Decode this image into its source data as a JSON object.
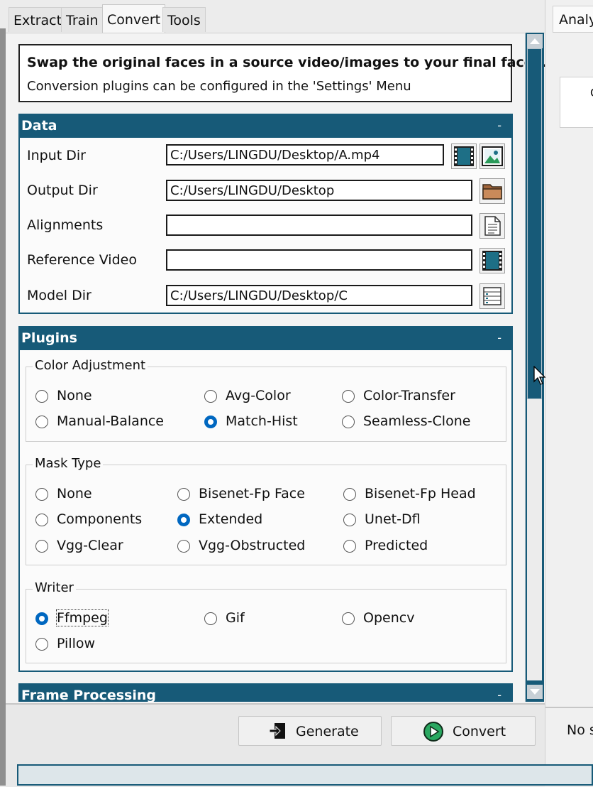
{
  "tabs": [
    "Extract",
    "Train",
    "Convert",
    "Tools"
  ],
  "right_tab": "Analy",
  "right_panel": {
    "box_char": "C",
    "status_text": "No s"
  },
  "description": {
    "title": "Swap the original faces in a source video/images to your final faces.",
    "subtitle": "Conversion plugins can be configured in the 'Settings' Menu"
  },
  "sections": {
    "data": {
      "title": "Data",
      "collapse": "-"
    },
    "plugins": {
      "title": "Plugins",
      "collapse": "-"
    },
    "frame": {
      "title": "Frame Processing",
      "collapse": "-"
    }
  },
  "fields": {
    "input_dir": {
      "label": "Input Dir",
      "value": "C:/Users/LINGDU/Desktop/A.mp4"
    },
    "output_dir": {
      "label": "Output Dir",
      "value": "C:/Users/LINGDU/Desktop"
    },
    "alignments": {
      "label": "Alignments",
      "value": ""
    },
    "reference_video": {
      "label": "Reference Video",
      "value": ""
    },
    "model_dir": {
      "label": "Model Dir",
      "value": "C:/Users/LINGDU/Desktop/C"
    }
  },
  "color_adjustment": {
    "title": "Color Adjustment",
    "options": [
      "None",
      "Avg-Color",
      "Color-Transfer",
      "Manual-Balance",
      "Match-Hist",
      "Seamless-Clone"
    ],
    "selected": "Match-Hist"
  },
  "mask_type": {
    "title": "Mask Type",
    "options": [
      "None",
      "Bisenet-Fp Face",
      "Bisenet-Fp Head",
      "Components",
      "Extended",
      "Unet-Dfl",
      "Vgg-Clear",
      "Vgg-Obstructed",
      "Predicted"
    ],
    "selected": "Extended"
  },
  "writer": {
    "title": "Writer",
    "options": [
      "Ffmpeg",
      "Gif",
      "Opencv",
      "Pillow"
    ],
    "selected": "Ffmpeg"
  },
  "buttons": {
    "generate": "Generate",
    "convert": "Convert"
  },
  "icons": [
    "video-icon",
    "image-icon",
    "folder-icon",
    "document-icon",
    "video-icon",
    "model-icon",
    "generate-icon",
    "play-icon"
  ],
  "colors": {
    "accent": "#175a78",
    "radio": "#0067c0"
  }
}
